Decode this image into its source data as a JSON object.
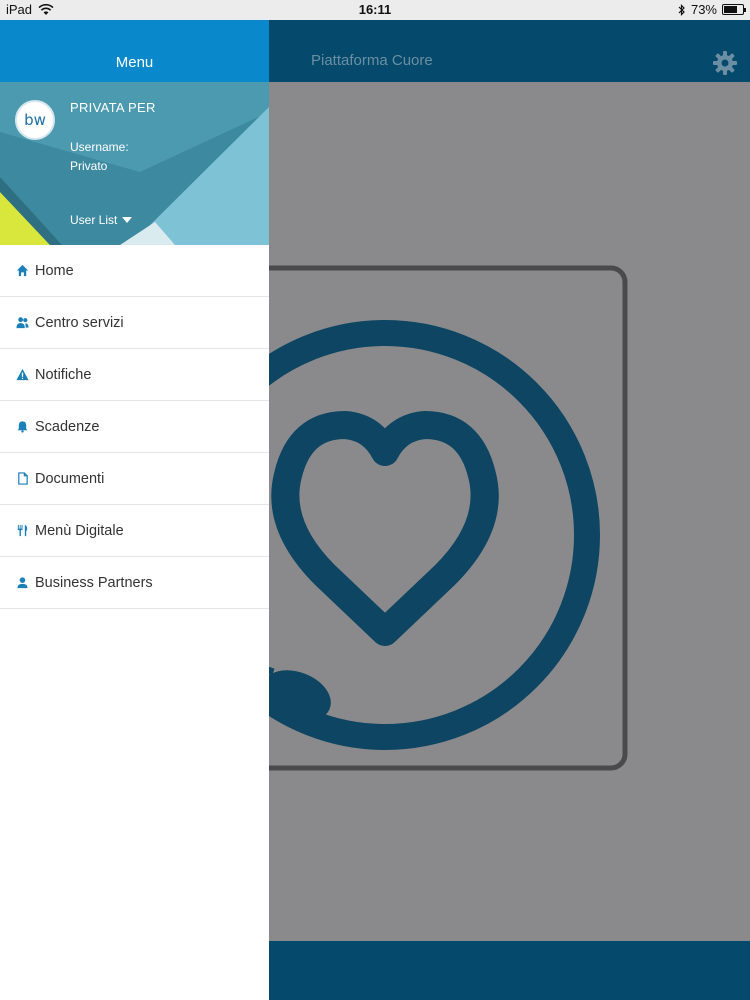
{
  "status_bar": {
    "device": "iPad",
    "time": "16:11",
    "battery": "73%",
    "battery_level": 0.73,
    "icons": [
      "wifi-icon",
      "bluetooth-icon",
      "battery-icon"
    ]
  },
  "app_bar": {
    "title": "Piattaforma Cuore",
    "settings_icon": "gear-icon"
  },
  "drawer": {
    "header": "Menu",
    "profile": {
      "avatar_text": "bw",
      "name": "PRIVATA PER",
      "username_label": "Username:",
      "username_value": "Privato",
      "user_list_label": "User List"
    },
    "items": [
      {
        "label": "Home",
        "icon": "home-icon"
      },
      {
        "label": "Centro servizi",
        "icon": "users-icon"
      },
      {
        "label": "Notifiche",
        "icon": "warning-icon"
      },
      {
        "label": "Scadenze",
        "icon": "bell-icon"
      },
      {
        "label": "Documenti",
        "icon": "document-icon"
      },
      {
        "label": "Menù Digitale",
        "icon": "fork-knife-icon"
      },
      {
        "label": "Business Partners",
        "icon": "person-icon"
      }
    ]
  },
  "colors": {
    "drawer_header": "#0a88cc",
    "app_bar": "#054a6c",
    "overlay_bg": "#8a8a8c",
    "icon_blue": "#1b7fb8"
  }
}
